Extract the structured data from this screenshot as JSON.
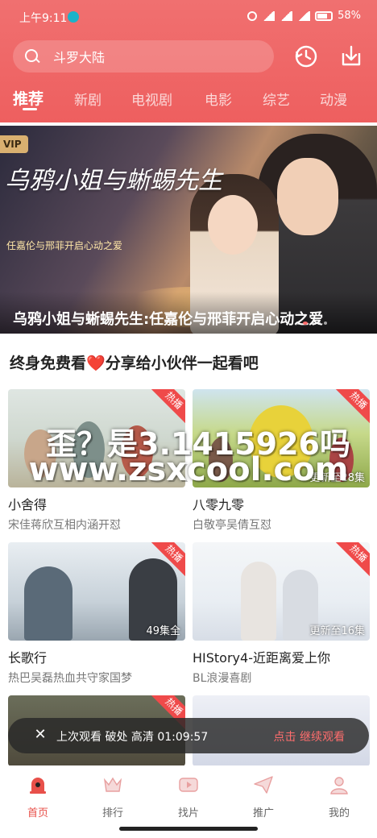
{
  "status": {
    "time": "上午9:11",
    "battery": "58%"
  },
  "search": {
    "query": "斗罗大陆"
  },
  "tabs": [
    {
      "label": "推荐",
      "active": true
    },
    {
      "label": "新剧"
    },
    {
      "label": "电视剧"
    },
    {
      "label": "电影"
    },
    {
      "label": "综艺"
    },
    {
      "label": "动漫"
    }
  ],
  "banner": {
    "vip": "VIP",
    "title_art": "乌鸦小姐与蜥蜴先生",
    "sub_art": "任嘉伦与邢菲开启心动之爱",
    "caption": "乌鸦小姐与蜥蜴先生:任嘉伦与邢菲开启心动之爱"
  },
  "section": {
    "title_pre": "终身免费看",
    "heart": "❤️",
    "title_post": "分享给小伙伴一起看吧"
  },
  "cards": [
    {
      "title": "小舍得",
      "sub": "宋佳蒋欣互相内涵开怼",
      "badge": "热播",
      "ep": ""
    },
    {
      "title": "八零九零",
      "sub": "白敬亭吴倩互怼",
      "badge": "热播",
      "ep": "更新至28集"
    },
    {
      "title": "长歌行",
      "sub": "热巴吴磊热血共守家国梦",
      "badge": "热播",
      "ep": "49集全"
    },
    {
      "title": "HIStory4-近距离爱上你",
      "sub": "BL浪漫喜剧",
      "badge": "热播",
      "ep": "更新至16集"
    },
    {
      "title": "",
      "sub": "",
      "badge": "热播",
      "ep": ""
    },
    {
      "title": "",
      "sub": "",
      "badge": "",
      "ep": ""
    }
  ],
  "watermark": {
    "line1": "歪？是3.1415926吗",
    "line2": "www.zsxcool.com"
  },
  "resume": {
    "close": "✕",
    "text": "上次观看 破处 高清  01:09:57",
    "cta": "点击 继续观看"
  },
  "nav": [
    {
      "label": "首页",
      "active": true
    },
    {
      "label": "排行"
    },
    {
      "label": "找片"
    },
    {
      "label": "推广"
    },
    {
      "label": "我的"
    }
  ],
  "colors": {
    "accent": "#ee5f5f",
    "hot": "#ef4a4a",
    "nav_active": "#e8504a"
  }
}
